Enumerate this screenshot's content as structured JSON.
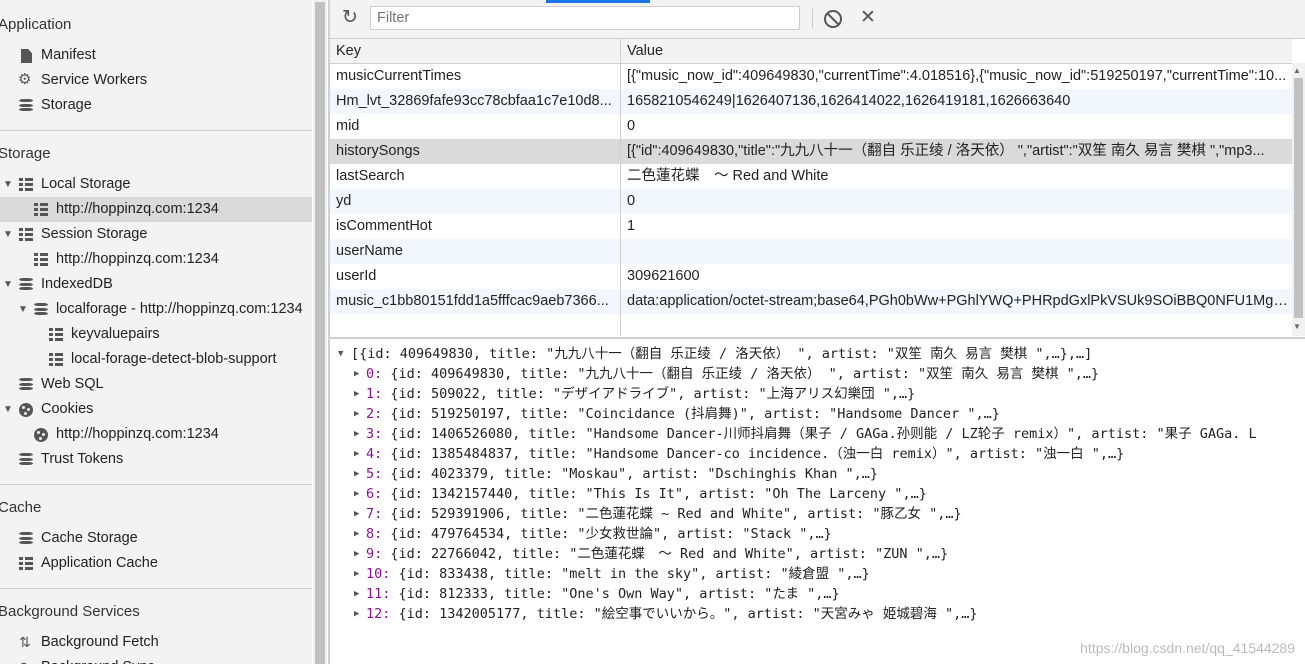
{
  "sidebar": {
    "application_heading": "Application",
    "application_items": [
      "Manifest",
      "Service Workers",
      "Storage"
    ],
    "storage_heading": "Storage",
    "local_storage": "Local Storage",
    "local_storage_origin": "http://hoppinzq.com:1234",
    "session_storage": "Session Storage",
    "session_storage_origin": "http://hoppinzq.com:1234",
    "indexeddb": "IndexedDB",
    "localforage": "localforage - http://hoppinzq.com:1234",
    "store_keyvaluepairs": "keyvaluepairs",
    "store_detect": "local-forage-detect-blob-support",
    "websql": "Web SQL",
    "cookies": "Cookies",
    "cookies_origin": "http://hoppinzq.com:1234",
    "trust_tokens": "Trust Tokens",
    "cache_heading": "Cache",
    "cache_storage": "Cache Storage",
    "application_cache": "Application Cache",
    "background_heading": "Background Services",
    "background_fetch": "Background Fetch",
    "background_sync": "Background Sync"
  },
  "toolbar": {
    "filter_placeholder": "Filter",
    "filter_value": ""
  },
  "table": {
    "header_key": "Key",
    "header_value": "Value",
    "rows": [
      {
        "key": "musicCurrentTimes",
        "value": "[{\"music_now_id\":409649830,\"currentTime\":4.018516},{\"music_now_id\":519250197,\"currentTime\":10..."
      },
      {
        "key": "Hm_lvt_32869fafe93cc78cbfaa1c7e10d8...",
        "value": "1658210546249|1626407136,1626414022,1626419181,1626663640"
      },
      {
        "key": "mid",
        "value": "0"
      },
      {
        "key": "historySongs",
        "value": "[{\"id\":409649830,\"title\":\"九九八十一（翻自 乐正绫 / 洛天依） \",\"artist\":\"双笙 南久 易言 樊棋 \",\"mp3..."
      },
      {
        "key": "lastSearch",
        "value": "二色蓮花蝶　～ Red and White"
      },
      {
        "key": "yd",
        "value": "0"
      },
      {
        "key": "isCommentHot",
        "value": "1"
      },
      {
        "key": "userName",
        "value": ""
      },
      {
        "key": "userId",
        "value": "309621600"
      },
      {
        "key": "music_c1bb80151fdd1a5fffcac9aeb7366...",
        "value": "data:application/octet-stream;base64,PGh0bWw+PGhlYWQ+PHRpdGxlPkVSUk9SOiBBQ0NFU1MgRg..."
      }
    ]
  },
  "preview": {
    "root": "[{id: 409649830, title: \"九九八十一（翻自 乐正绫 / 洛天依） \", artist: \"双笙 南久 易言 樊棋 \",…},…]",
    "items": [
      {
        "idx": "0:",
        "text": " {id: 409649830, title: \"九九八十一（翻自 乐正绫 / 洛天依） \", artist: \"双笙 南久 易言 樊棋 \",…}"
      },
      {
        "idx": "1:",
        "text": " {id: 509022, title: \"デザイアドライブ\", artist: \"上海アリス幻樂団 \",…}"
      },
      {
        "idx": "2:",
        "text": " {id: 519250197, title: \"Coincidance (抖肩舞)\", artist: \"Handsome Dancer \",…}"
      },
      {
        "idx": "3:",
        "text": " {id: 1406526080, title: \"Handsome Dancer-川师抖肩舞（果子 / GAGa.孙则能 / LZ轮子 remix）\", artist: \"果子 GAGa. L"
      },
      {
        "idx": "4:",
        "text": " {id: 1385484837, title: \"Handsome Dancer-co incidence.（浊一白 remix）\", artist: \"浊一白 \",…}"
      },
      {
        "idx": "5:",
        "text": " {id: 4023379, title: \"Moskau\", artist: \"Dschinghis Khan \",…}"
      },
      {
        "idx": "6:",
        "text": " {id: 1342157440, title: \"This Is It\", artist: \"Oh The Larceny \",…}"
      },
      {
        "idx": "7:",
        "text": " {id: 529391906, title: \"二色蓮花蝶 ~ Red and White\", artist: \"豚乙女 \",…}"
      },
      {
        "idx": "8:",
        "text": " {id: 479764534, title: \"少女救世論\", artist: \"Stack \",…}"
      },
      {
        "idx": "9:",
        "text": " {id: 22766042, title: \"二色蓮花蝶　～ Red and White\", artist: \"ZUN \",…}"
      },
      {
        "idx": "10:",
        "text": " {id: 833438, title: \"melt in the sky\", artist: \"綾倉盟 \",…}"
      },
      {
        "idx": "11:",
        "text": " {id: 812333, title: \"One's Own Way\", artist: \"たま \",…}"
      },
      {
        "idx": "12:",
        "text": " {id: 1342005177, title: \"絵空事でいいから。\", artist: \"天宮みゃ 姫城碧海 \",…}"
      }
    ]
  },
  "watermark": "https://blog.csdn.net/qq_41544289"
}
